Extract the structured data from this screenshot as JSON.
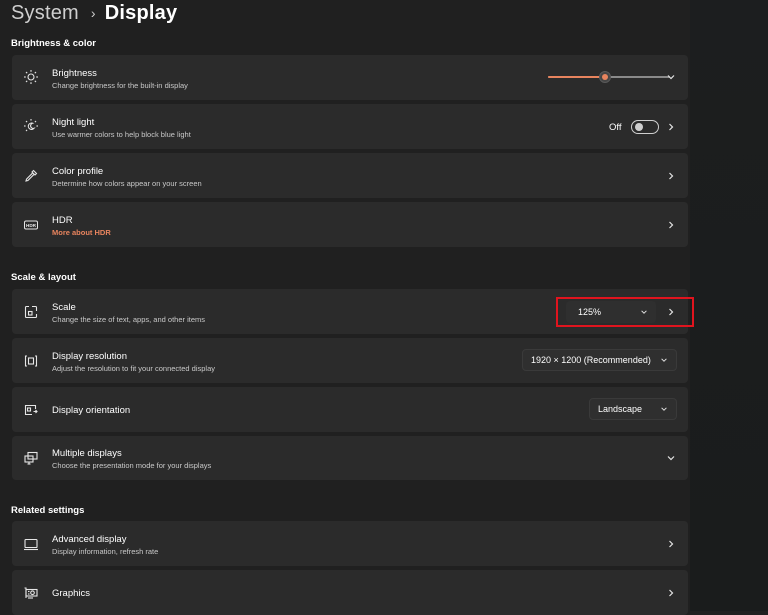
{
  "breadcrumb": {
    "parent": "System",
    "separator": "›",
    "current": "Display"
  },
  "sections": {
    "brightness_color": "Brightness & color",
    "scale_layout": "Scale & layout",
    "related": "Related settings"
  },
  "brightness": {
    "title": "Brightness",
    "desc": "Change brightness for the built-in display",
    "icon": "sun-icon",
    "level_percent": 47
  },
  "night_light": {
    "title": "Night light",
    "desc": "Use warmer colors to help block blue light",
    "icon": "night-light-icon",
    "state_label": "Off",
    "enabled": false
  },
  "color_profile": {
    "title": "Color profile",
    "desc": "Determine how colors appear on your screen",
    "icon": "eyedropper-icon"
  },
  "hdr": {
    "title": "HDR",
    "link": "More about HDR",
    "icon": "hdr-icon"
  },
  "scale": {
    "title": "Scale",
    "desc": "Change the size of text, apps, and other items",
    "icon": "scale-icon",
    "value": "125%"
  },
  "resolution": {
    "title": "Display resolution",
    "desc": "Adjust the resolution to fit your connected display",
    "icon": "resolution-icon",
    "value": "1920 × 1200 (Recommended)"
  },
  "orientation": {
    "title": "Display orientation",
    "icon": "orientation-icon",
    "value": "Landscape"
  },
  "multiple_displays": {
    "title": "Multiple displays",
    "desc": "Choose the presentation mode for your displays",
    "icon": "multiple-displays-icon"
  },
  "advanced_display": {
    "title": "Advanced display",
    "desc": "Display information, refresh rate",
    "icon": "monitor-icon"
  },
  "graphics": {
    "title": "Graphics",
    "icon": "graphics-card-icon"
  },
  "colors": {
    "accent": "#e8845e",
    "highlight": "#e0141e",
    "card": "#2b2b2b",
    "background": "#202020"
  }
}
